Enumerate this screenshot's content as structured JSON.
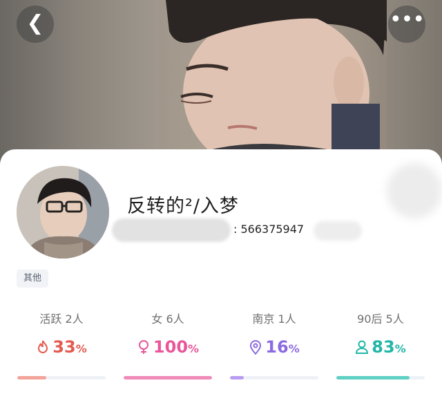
{
  "header": {
    "back_icon": "chevron-left-icon",
    "more_icon": "more-dots-icon"
  },
  "profile": {
    "username": "反转的²/入梦",
    "id_text": ": 566375947",
    "tag": "其他"
  },
  "stats": [
    {
      "label": "活跃 2人",
      "value": "33",
      "unit": "%",
      "icon": "flame-icon",
      "color": "#e35a4f",
      "track_color": "#f2a49a",
      "progress": 0.33
    },
    {
      "label": "女 6人",
      "value": "100",
      "unit": "%",
      "icon": "female-icon",
      "color": "#e8579a",
      "track_color": "#f08ab8",
      "progress": 1.0
    },
    {
      "label": "南京 1人",
      "value": "16",
      "unit": "%",
      "icon": "location-pin-icon",
      "color": "#8c6be0",
      "track_color": "#b89df0",
      "progress": 0.16
    },
    {
      "label": "90后 5人",
      "value": "83",
      "unit": "%",
      "icon": "person-icon",
      "color": "#22b6a8",
      "track_color": "#5ed0c4",
      "progress": 0.83
    }
  ]
}
